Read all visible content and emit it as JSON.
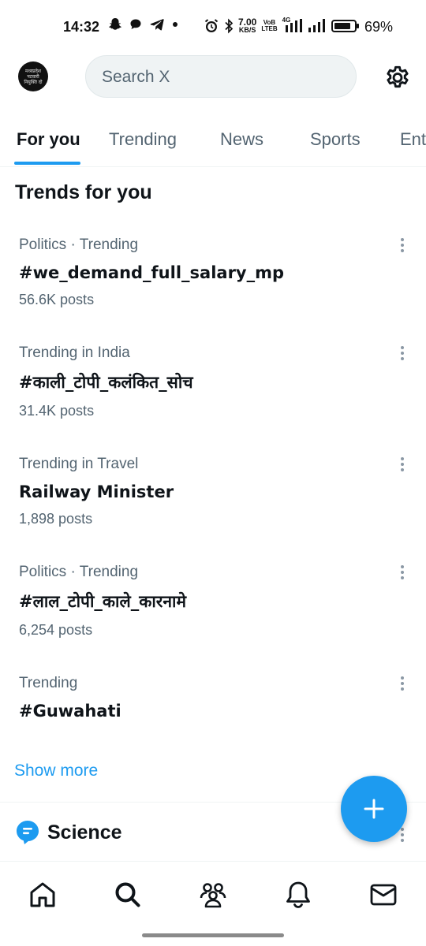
{
  "status_bar": {
    "time": "14:32",
    "net_speed_value": "7.00",
    "net_speed_unit": "KB/S",
    "volte_top": "VoB",
    "volte_bottom": "LTEB",
    "signal_label": "4G",
    "battery_percent": "69%"
  },
  "header": {
    "avatar_text_line1": "मध्यप्रदेश",
    "avatar_text_line2": "पटवारी",
    "avatar_text_line3": "नियुक्ति दो",
    "search_placeholder": "Search X"
  },
  "tabs": [
    {
      "label": "For you",
      "active": true
    },
    {
      "label": "Trending",
      "active": false
    },
    {
      "label": "News",
      "active": false
    },
    {
      "label": "Sports",
      "active": false
    },
    {
      "label": "Ent",
      "active": false
    }
  ],
  "section_title": "Trends for you",
  "trends": [
    {
      "meta": "Politics · Trending",
      "name": "#we_demand_full_salary_mp",
      "count": "56.6K posts"
    },
    {
      "meta": "Trending in India",
      "name": "#काली_टोपी_कलंकित_सोच",
      "count": "31.4K posts"
    },
    {
      "meta": "Trending in Travel",
      "name": "Railway Minister",
      "count": "1,898 posts"
    },
    {
      "meta": "Politics · Trending",
      "name": "#लाल_टोपी_काले_कारनामे",
      "count": "6,254 posts"
    },
    {
      "meta": "Trending",
      "name": "#Guwahati",
      "count": ""
    }
  ],
  "show_more": "Show more",
  "next_section": {
    "label": "Science",
    "icon": "topic-bubble-icon"
  },
  "fab": {
    "icon": "plus-icon"
  },
  "bottom_nav": [
    {
      "icon": "home-icon"
    },
    {
      "icon": "search-icon"
    },
    {
      "icon": "communities-icon"
    },
    {
      "icon": "bell-icon"
    },
    {
      "icon": "mail-icon"
    }
  ],
  "colors": {
    "accent": "#1d9bf0",
    "text_primary": "#0f1419",
    "text_secondary": "#536471",
    "search_bg": "#eff3f4"
  }
}
